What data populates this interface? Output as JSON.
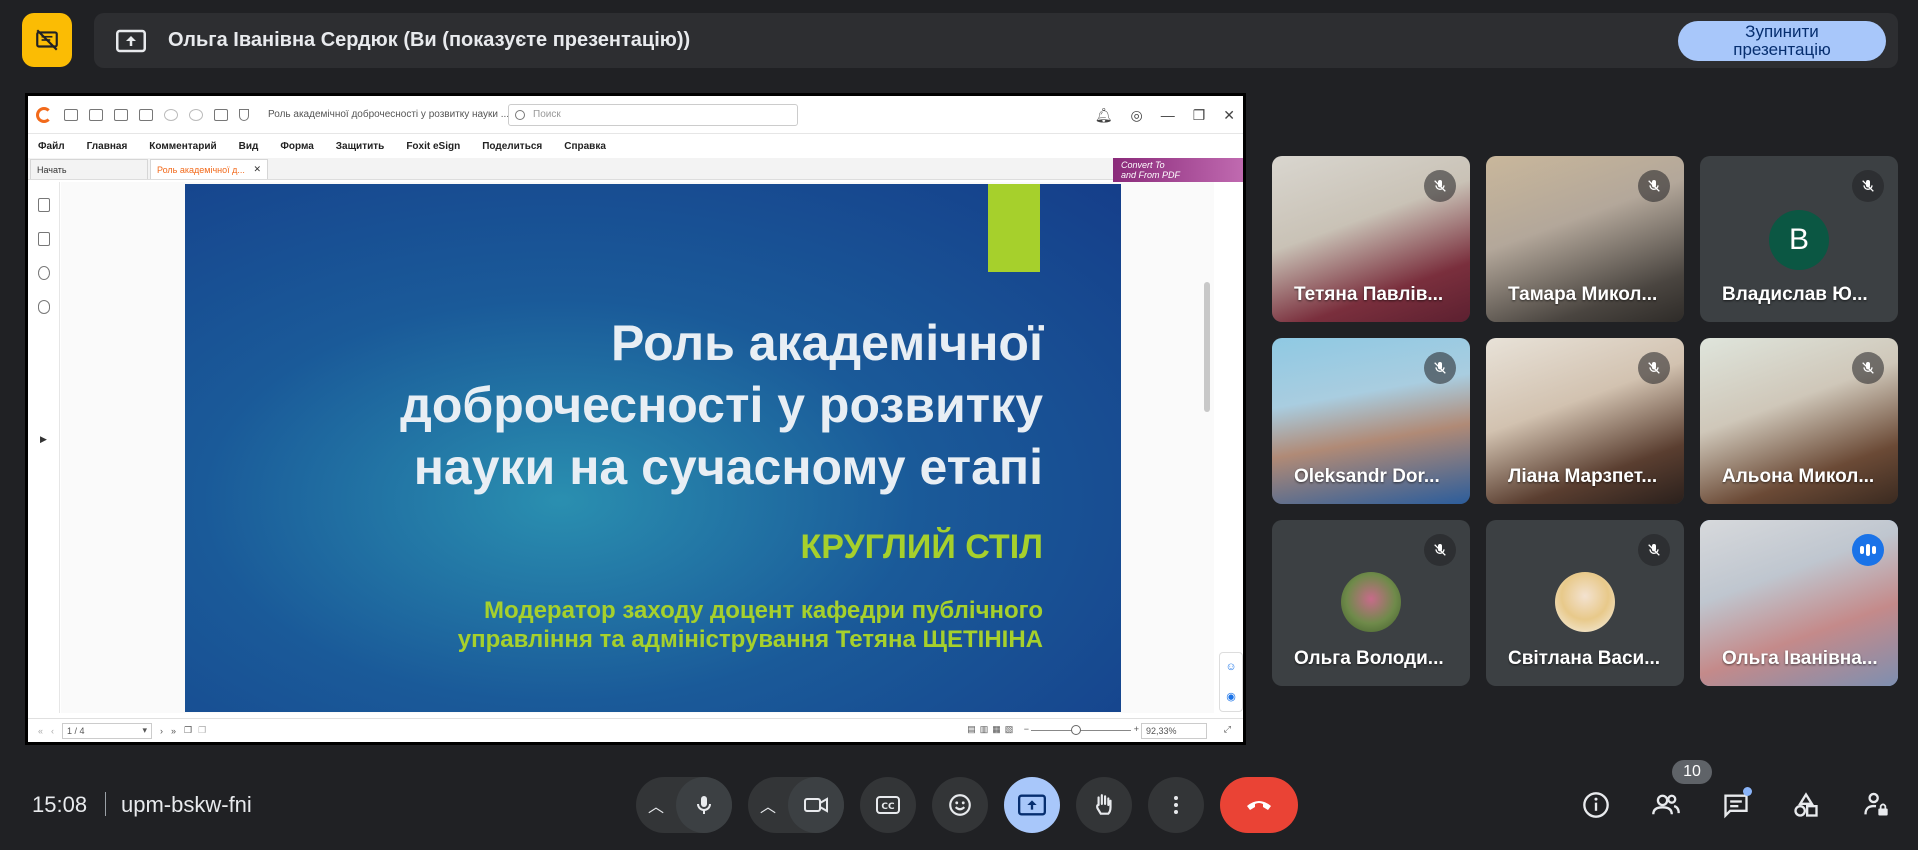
{
  "banner": {
    "title": "Ольга Іванівна Сердюк (Ви (показуєте презентацію))",
    "stop_label": "Зупинити презентацію"
  },
  "shared_app": {
    "doc_title": "Роль академічної доброчесності у розвитку науки ...",
    "search_placeholder": "Поиск",
    "menu": [
      "Файл",
      "Главная",
      "Комментарий",
      "Вид",
      "Форма",
      "Защитить",
      "Foxit eSign",
      "Поделиться",
      "Справка"
    ],
    "tabs": [
      {
        "label": "Начать"
      },
      {
        "label": "Роль академічної д..."
      }
    ],
    "convert_banner": [
      "Convert To",
      "and From PDF"
    ],
    "page_indicator": "1 / 4",
    "zoom": "92,33%",
    "zoom_level_percent": 45
  },
  "slide": {
    "title_lines": [
      "Роль академічної",
      "доброчесності у розвитку",
      "науки на сучасному етапі"
    ],
    "subtitle": "КРУГЛИЙ СТІЛ",
    "moderator_lines": [
      "Модератор заходу доцент кафедри публічного",
      "управління та адміністрування Тетяна ЩЕТІНІНА"
    ],
    "accent_color": "#a6d02c"
  },
  "participants": [
    {
      "name": "Тетяна Павлів...",
      "muted": true
    },
    {
      "name": "Тамара Микол...",
      "muted": true
    },
    {
      "name": "Владислав Ю...",
      "muted": true,
      "avatar_letter": "B"
    },
    {
      "name": "Oleksandr Dor...",
      "muted": true
    },
    {
      "name": "Ліана Марзпет...",
      "muted": true
    },
    {
      "name": "Альона Микол...",
      "muted": true
    },
    {
      "name": "Ольга Володи...",
      "muted": true
    },
    {
      "name": "Світлана Васи...",
      "muted": true
    },
    {
      "name": "Ольга Іванівна...",
      "muted": false,
      "speaking": true
    }
  ],
  "bottom_bar": {
    "time": "15:08",
    "meeting_code": "upm-bskw-fni",
    "people_count": "10"
  },
  "colors": {
    "background": "#202124",
    "present_yellow": "#fbbc04",
    "stop_button": "#a8c7fa",
    "hangup_red": "#ea4335",
    "speaking_outline": "#8ab4f8"
  }
}
